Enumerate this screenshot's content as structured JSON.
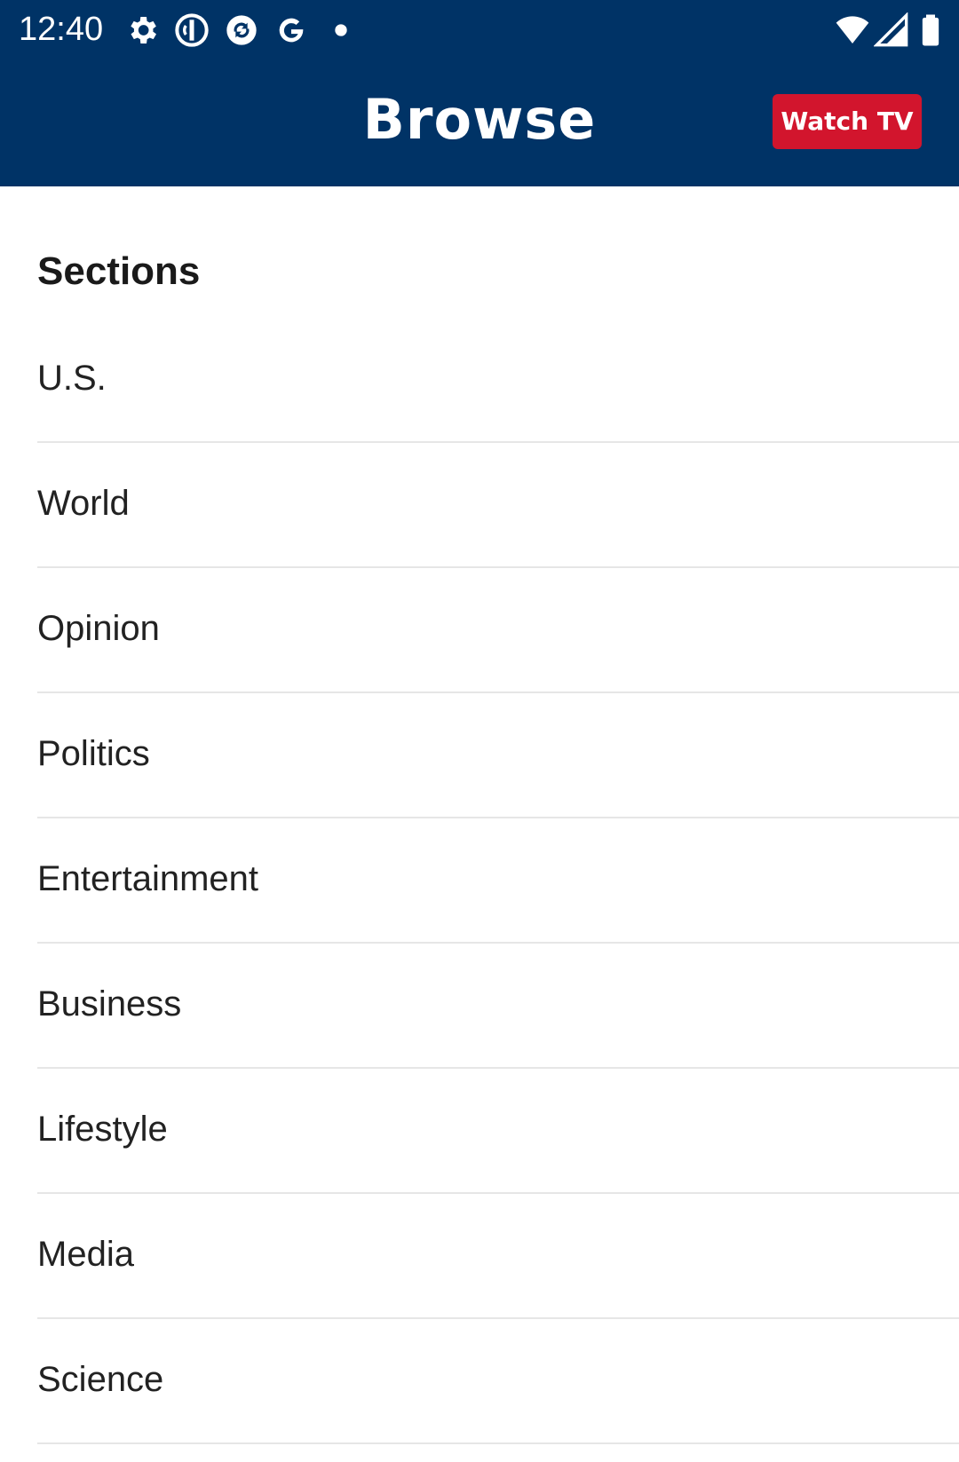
{
  "status_bar": {
    "time": "12:40",
    "left_icons": [
      "gear-icon",
      "google-one-icon",
      "app-refresh-icon",
      "google-g-icon",
      "notification-dot-icon"
    ],
    "right_icons": [
      "wifi-icon",
      "cell-signal-icon",
      "battery-icon"
    ]
  },
  "header": {
    "title": "Browse",
    "watch_tv_label": "Watch TV"
  },
  "sections": {
    "heading": "Sections",
    "items": [
      {
        "label": "U.S."
      },
      {
        "label": "World"
      },
      {
        "label": "Opinion"
      },
      {
        "label": "Politics"
      },
      {
        "label": "Entertainment"
      },
      {
        "label": "Business"
      },
      {
        "label": "Lifestyle"
      },
      {
        "label": "Media"
      },
      {
        "label": "Science"
      }
    ]
  },
  "colors": {
    "header_bg": "#003366",
    "accent_red": "#d2152d",
    "divider": "#e6e6e6",
    "text": "#222222"
  }
}
